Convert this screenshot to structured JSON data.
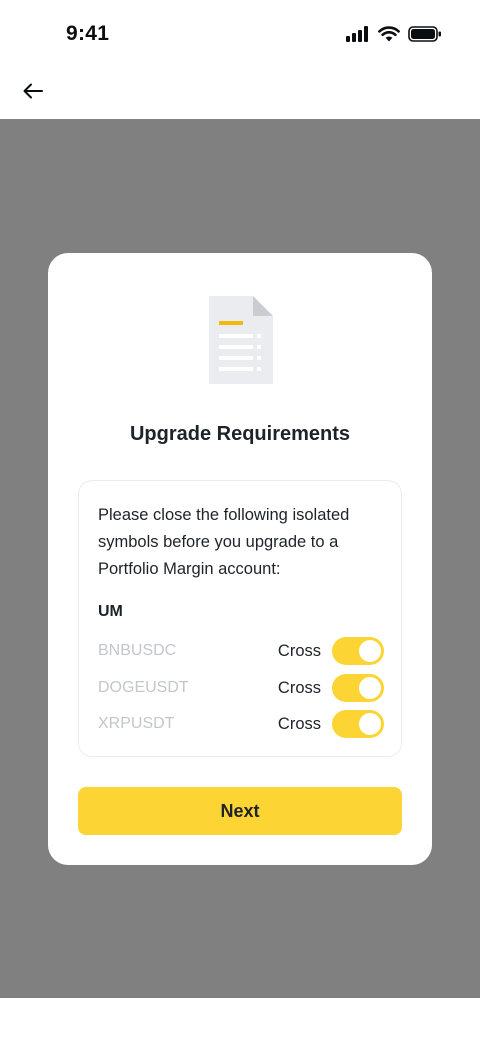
{
  "status_bar": {
    "time": "9:41",
    "icons": [
      "signal-icon",
      "wifi-icon",
      "battery-icon"
    ]
  },
  "nav": {
    "back_icon": "arrow-left-icon"
  },
  "modal": {
    "illustration": "document-icon",
    "title": "Upgrade Requirements",
    "message": "Please close the following isolated symbols before you upgrade to a Portfolio Margin account:",
    "group_label": "UM",
    "symbols": [
      {
        "name": "BNBUSDC",
        "mode": "Cross",
        "toggle_on": true
      },
      {
        "name": "DOGEUSDT",
        "mode": "Cross",
        "toggle_on": true
      },
      {
        "name": "XRPUSDT",
        "mode": "Cross",
        "toggle_on": true
      }
    ],
    "next_label": "Next"
  },
  "colors": {
    "accent": "#FCD535",
    "overlay": "#808080",
    "muted_text": "#C4C6CA",
    "primary_text": "#1E2329"
  }
}
